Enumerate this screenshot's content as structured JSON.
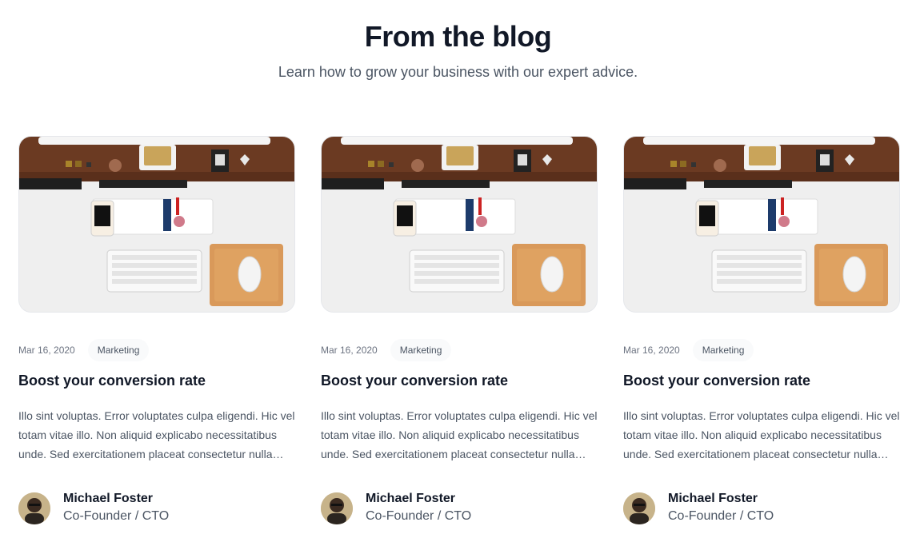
{
  "header": {
    "title": "From the blog",
    "subtitle": "Learn how to grow your business with our expert advice."
  },
  "posts": [
    {
      "date": "Mar 16, 2020",
      "category": "Marketing",
      "title": "Boost your conversion rate",
      "excerpt": "Illo sint voluptas. Error voluptates culpa eligendi. Hic vel totam vitae illo. Non aliquid explicabo necessitatibus unde. Sed exercitationem placeat consectetur nulla deserunt vel. Iusto corrupti dicta.",
      "author": {
        "name": "Michael Foster",
        "role": "Co-Founder / CTO"
      },
      "image_icon": "desk-workspace-photo"
    },
    {
      "date": "Mar 16, 2020",
      "category": "Marketing",
      "title": "Boost your conversion rate",
      "excerpt": "Illo sint voluptas. Error voluptates culpa eligendi. Hic vel totam vitae illo. Non aliquid explicabo necessitatibus unde. Sed exercitationem placeat consectetur nulla deserunt vel. Iusto corrupti dicta.",
      "author": {
        "name": "Michael Foster",
        "role": "Co-Founder / CTO"
      },
      "image_icon": "desk-workspace-photo"
    },
    {
      "date": "Mar 16, 2020",
      "category": "Marketing",
      "title": "Boost your conversion rate",
      "excerpt": "Illo sint voluptas. Error voluptates culpa eligendi. Hic vel totam vitae illo. Non aliquid explicabo necessitatibus unde. Sed exercitationem placeat consectetur nulla deserunt vel. Iusto corrupti dicta.",
      "author": {
        "name": "Michael Foster",
        "role": "Co-Founder / CTO"
      },
      "image_icon": "desk-workspace-photo"
    }
  ],
  "colors": {
    "heading": "#111827",
    "body_text": "#4b5563",
    "muted": "#6b7280",
    "tag_bg": "#f9fafb",
    "desk_wood": "#6b3a22",
    "mousepad": "#d9995a"
  }
}
